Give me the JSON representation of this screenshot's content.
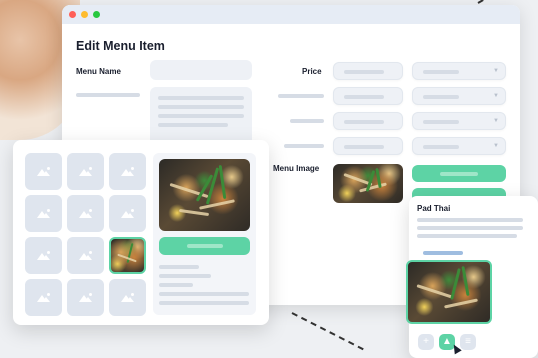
{
  "window": {
    "title": "Edit Menu Item",
    "labels": {
      "menu_name": "Menu Name",
      "price": "Price",
      "menu_image": "Menu Image"
    }
  },
  "card": {
    "title": "Pad Thai"
  },
  "icons": {
    "image": "image-icon",
    "add": "plus-icon",
    "menu": "list-icon"
  },
  "colors": {
    "accent": "#5dd3a5",
    "placeholder": "#dfe5ee"
  }
}
